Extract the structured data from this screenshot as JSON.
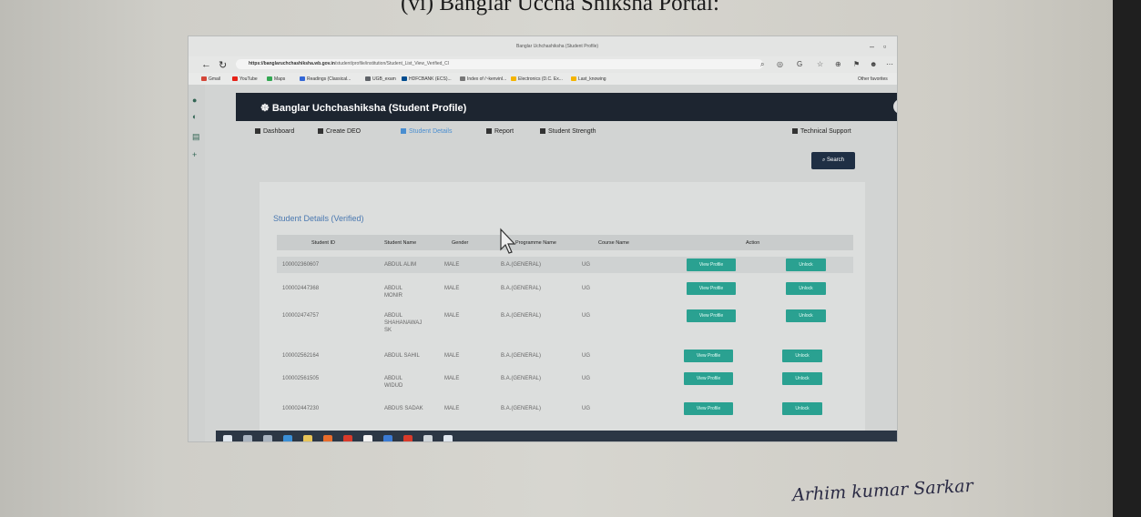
{
  "document": {
    "heading": "(vi) Banglar Uccha Shiksha Portal:",
    "signature": "Arhim kumar Sarkar"
  },
  "browser": {
    "window_title": "Banglar Uchchashiksha (Student Profile)",
    "url_host": "https://banglaruchchashiksha.wb.gov.in",
    "url_path": "/student/profile/institution/Student_List_View_Verified_Cl",
    "bookmarks": [
      {
        "label": "Gmail",
        "color": "#d44638"
      },
      {
        "label": "YouTube",
        "color": "#e62117"
      },
      {
        "label": "Maps",
        "color": "#34a853"
      },
      {
        "label": "Readings (Classical...",
        "color": "#3367d6"
      },
      {
        "label": "UGB_exam",
        "color": "#5f6368"
      },
      {
        "label": "HDFCBANK (ECS)...",
        "color": "#004c8f"
      },
      {
        "label": "Index of /~kenvinl...",
        "color": "#777777"
      },
      {
        "label": "Electronics (D.C. Ex...",
        "color": "#f4b400"
      },
      {
        "label": "Last_knowing",
        "color": "#f4b400"
      }
    ],
    "other_bookmarks": "Other favorites"
  },
  "app": {
    "brand": "Banglar Uchchashiksha (Student Profile)",
    "menu": [
      {
        "label": "Dashboard",
        "active": false
      },
      {
        "label": "Create DEO",
        "active": false
      },
      {
        "label": "Student Details",
        "active": true
      },
      {
        "label": "Report",
        "active": false
      },
      {
        "label": "Student Strength",
        "active": false
      }
    ],
    "support": "Technical Support",
    "search_label": "Search",
    "section_title": "Student Details (Verified)",
    "columns": [
      "Student ID",
      "Student Name",
      "Gender",
      "Programme Name",
      "Course Name",
      "Action"
    ],
    "view_label": "View Profile",
    "unlock_label": "Unlock",
    "rows": [
      {
        "id": "100002360607",
        "name": "ABDUL ALIM",
        "gender": "MALE",
        "programme": "B.A.(GENERAL)",
        "course": "UG"
      },
      {
        "id": "100002447368",
        "name": "ABDUL\nMONIR",
        "gender": "MALE",
        "programme": "B.A.(GENERAL)",
        "course": "UG"
      },
      {
        "id": "100002474757",
        "name": "ABDUL\nSHAHANAWAJ\nSK",
        "gender": "MALE",
        "programme": "B.A.(GENERAL)",
        "course": "UG"
      },
      {
        "id": "100002562164",
        "name": "ABDUL SAHIL",
        "gender": "MALE",
        "programme": "B.A.(GENERAL)",
        "course": "UG"
      },
      {
        "id": "100002561505",
        "name": "ABDUL\nWIDUD",
        "gender": "MALE",
        "programme": "B.A.(GENERAL)",
        "course": "UG"
      },
      {
        "id": "100002447230",
        "name": "ABDUS SADAK",
        "gender": "MALE",
        "programme": "B.A.(GENERAL)",
        "course": "UG"
      }
    ]
  },
  "colors": {
    "header": "#1d2530",
    "accent": "#4a8ed0",
    "action_button": "#2aa191",
    "search_button": "#1f2f44"
  },
  "taskbar_icons": [
    "windows-icon",
    "search-icon",
    "task-view-icon",
    "edge-icon",
    "explorer-icon",
    "firefox-icon",
    "chrome-icon",
    "chrome-icon",
    "store-icon",
    "pdf-icon",
    "camera-icon",
    "settings-icon"
  ]
}
